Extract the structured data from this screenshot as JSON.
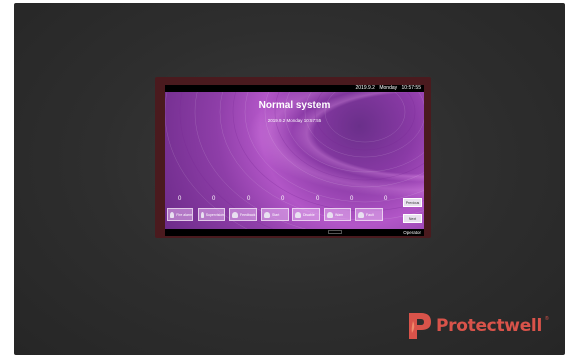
{
  "screen": {
    "topbar": {
      "date": "2019.9.2",
      "weekday": "Monday",
      "time": "10:57:55"
    },
    "title": "Normal system",
    "datetime": "2019.9.2  Monday   10:57:55",
    "counters": [
      "0",
      "0",
      "0",
      "0",
      "0",
      "0",
      "0"
    ],
    "categories": [
      {
        "label": "Fire alarm",
        "icon": "bell-icon"
      },
      {
        "label": "Supervision",
        "icon": "bell-icon"
      },
      {
        "label": "Feedback",
        "icon": "bell-icon"
      },
      {
        "label": "Start",
        "icon": "bell-icon"
      },
      {
        "label": "Disable",
        "icon": "bell-icon"
      },
      {
        "label": "Warn",
        "icon": "bell-icon"
      },
      {
        "label": "Fault",
        "icon": "bell-icon"
      }
    ],
    "previous_label": "Previous",
    "next_label": "Next",
    "user_level": "Operator"
  },
  "brand": {
    "name": "Protectwell",
    "registered": "®",
    "color": "#d9534a"
  },
  "colors": {
    "device": "#2e2e2e",
    "bezel": "#4a1a1e",
    "screen_purple": "#b256c7"
  }
}
